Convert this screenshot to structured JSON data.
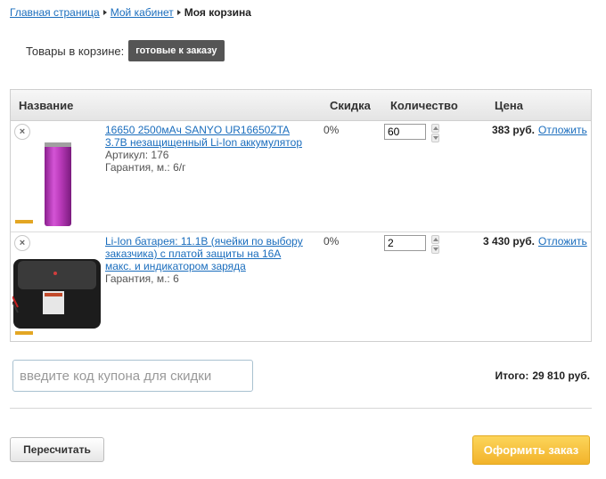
{
  "breadcrumb": {
    "home": "Главная страница",
    "cabinet": "Мой кабинет",
    "current": "Моя корзина"
  },
  "cart_status": {
    "label": "Товары в корзине:",
    "badge": "готовые к заказу"
  },
  "table": {
    "headers": {
      "name": "Название",
      "discount": "Скидка",
      "quantity": "Количество",
      "price": "Цена"
    },
    "rows": [
      {
        "name_line1": "16650 2500мАч SANYO UR16650ZTA",
        "name_line2": "3.7В незащищенный Li-Ion аккумулятор",
        "article": "Артикул: 176",
        "warranty": "Гарантия, м.: 6/г",
        "discount": "0%",
        "quantity": "60",
        "price": "383 руб.",
        "postpone": "Отложить",
        "remove_icon": "×",
        "image": "purple-cylindrical-battery-image"
      },
      {
        "name_line1": "Li-Ion батарея: 11.1В (ячейки по выбору",
        "name_line2": "заказчика) с платой защиты на 16А",
        "name_line3": "макс. и индикатором заряда",
        "warranty": "Гарантия, м.: 6",
        "discount": "0%",
        "quantity": "2",
        "price": "3 430 руб.",
        "postpone": "Отложить",
        "remove_icon": "×",
        "image": "black-battery-pack-image"
      }
    ]
  },
  "coupon": {
    "placeholder": "введите код купона для скидки"
  },
  "total": {
    "label": "Итого:",
    "value": "29 810 руб."
  },
  "buttons": {
    "recalculate": "Пересчитать",
    "checkout": "Оформить заказ"
  },
  "colors": {
    "link": "#1a6dbd",
    "badge_bg": "#555555",
    "checkout_bg": "#f5bd3c"
  }
}
